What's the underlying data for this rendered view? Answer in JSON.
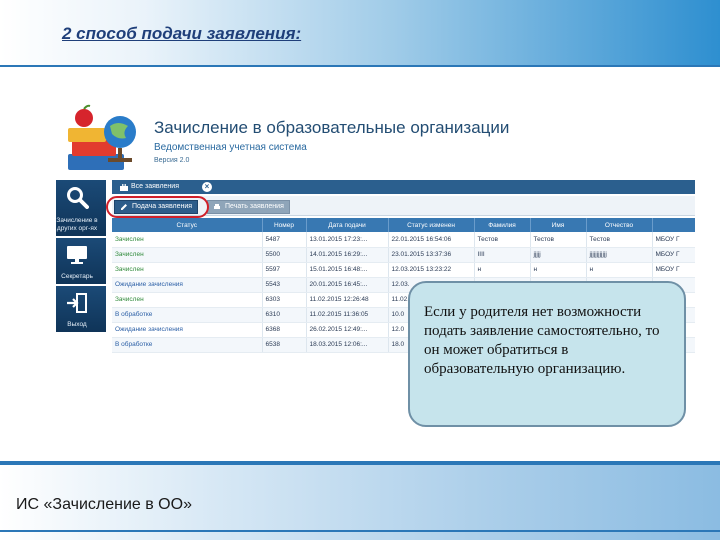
{
  "slide": {
    "heading": "2 способ подачи заявления:",
    "footer": "ИС «Зачисление в ОО»"
  },
  "app": {
    "title": "Зачисление в образовательные организации",
    "subtitle": "Ведомственная учетная система",
    "version": "Версия 2.0"
  },
  "nav": {
    "items": [
      {
        "label": "Зачисление в других орг-ях",
        "icon": "search-icon"
      },
      {
        "label": "Секретарь",
        "icon": "monitor-icon"
      },
      {
        "label": "Выход",
        "icon": "logout-icon"
      }
    ]
  },
  "tabs": {
    "active_label": "Все заявления",
    "close_glyph": "×"
  },
  "toolbar": {
    "submit_label": "Подача заявления",
    "print_label": "Печать заявления"
  },
  "table": {
    "columns": [
      "Статус",
      "Номер",
      "Дата подачи",
      "Статус изменен",
      "Фамилия",
      "Имя",
      "Отчество",
      ""
    ],
    "rows": [
      [
        "Зачислен",
        "5487",
        "13.01.2015 17:23:...",
        "22.01.2015 16:54:06",
        "Тестов",
        "Тестов",
        "Тестов",
        "МБОУ Г"
      ],
      [
        "Зачислен",
        "5500",
        "14.01.2015 16:29:...",
        "23.01.2015 13:37:36",
        "IIII",
        "jjjjj",
        "jjjjjjjjjjjj",
        "МБОУ Г"
      ],
      [
        "Зачислен",
        "5597",
        "15.01.2015 16:48:...",
        "12.03.2015 13:23:22",
        "н",
        "н",
        "н",
        "МБОУ Г"
      ],
      [
        "Ожидание зачисления",
        "5543",
        "20.01.2015 16:45:...",
        "12.03.",
        "",
        "",
        "",
        ""
      ],
      [
        "Зачислен",
        "6303",
        "11.02.2015 12:26:48",
        "11.02.",
        "",
        "",
        "",
        ""
      ],
      [
        "В обработке",
        "6310",
        "11.02.2015 11:36:05",
        "10.0",
        "",
        "",
        "",
        ""
      ],
      [
        "Ожидание зачисления",
        "6368",
        "26.02.2015 12:49:...",
        "12.0",
        "",
        "",
        "",
        ""
      ],
      [
        "В обработке",
        "6538",
        "18.03.2015 12:06:...",
        "18.0",
        "",
        "",
        "",
        ""
      ]
    ]
  },
  "callout": {
    "text": "Если у родителя нет возможности подать заявление самостоятельно, то он может обратиться в  образовательную организацию."
  }
}
